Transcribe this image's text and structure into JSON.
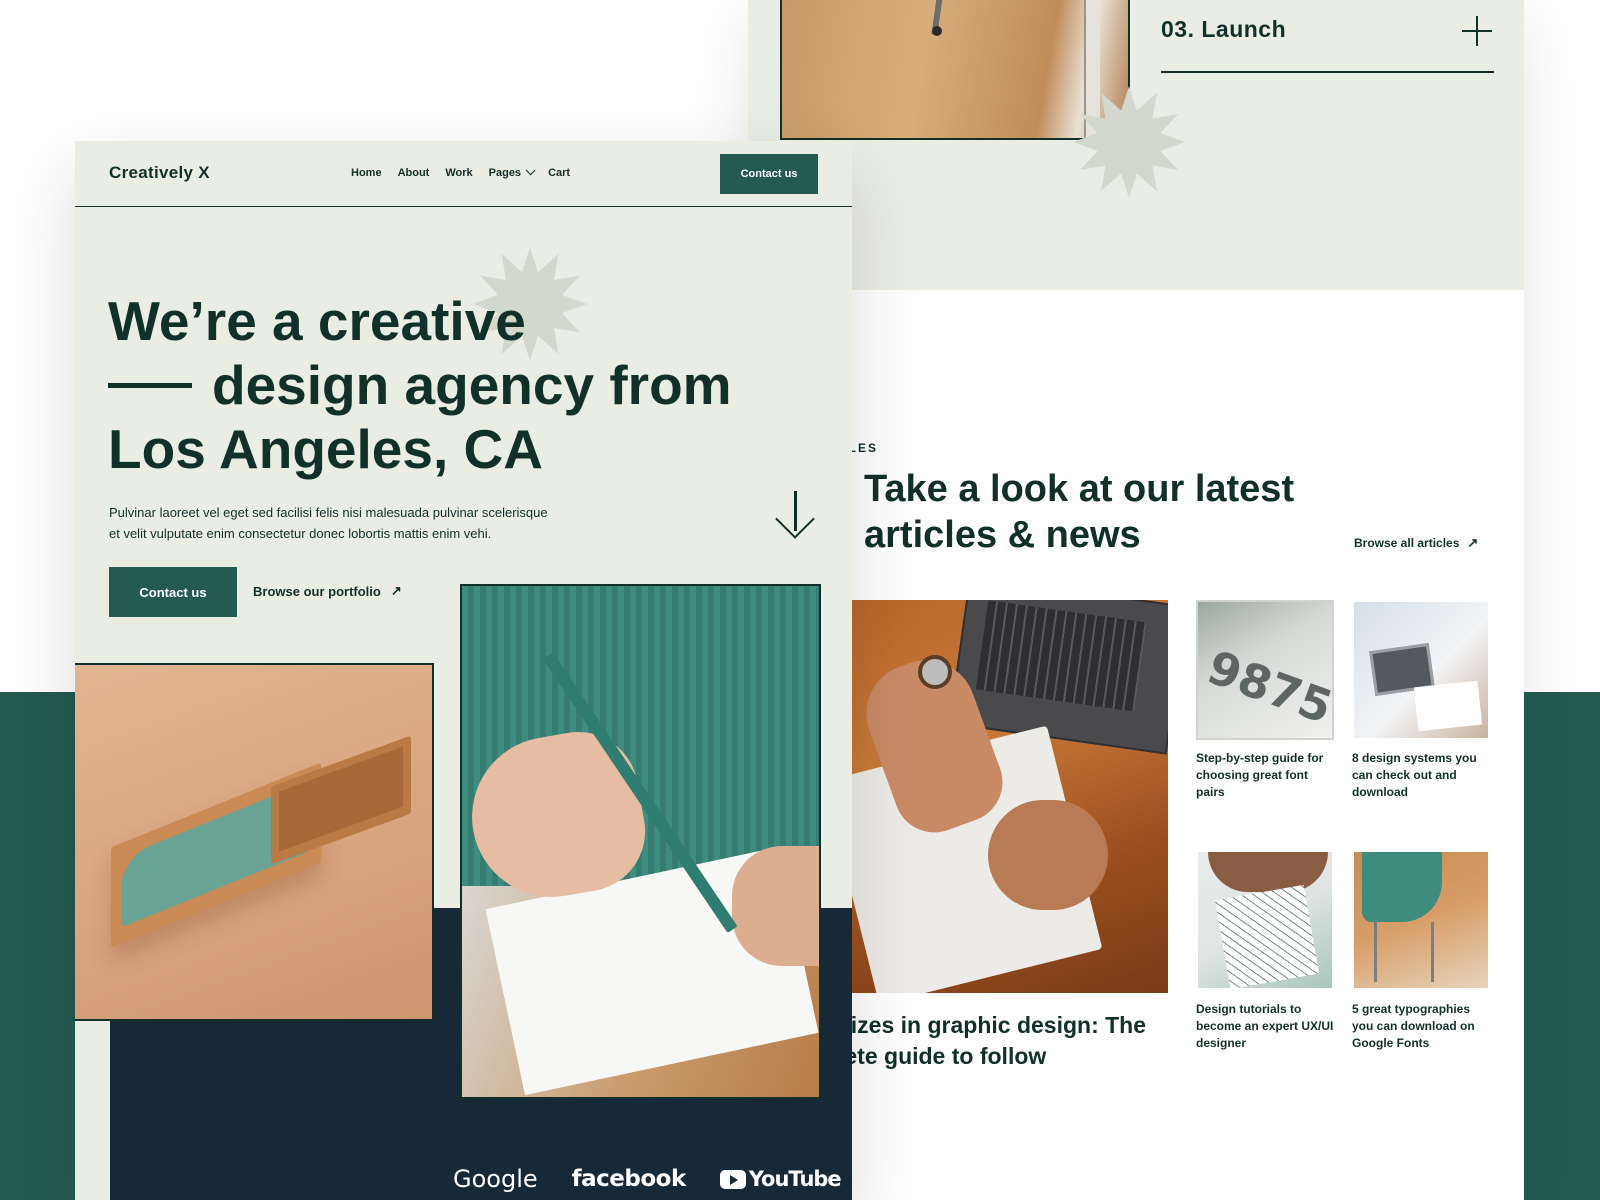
{
  "right_mockup": {
    "process": {
      "step_title": "03.  Launch"
    },
    "articles": {
      "eyebrow": "CLES",
      "heading_line1": "Take a look at our latest",
      "heading_line2": "articles & news",
      "browse_label": "Browse all articles",
      "featured_title_line1": "sizes in graphic design: The",
      "featured_title_line2": "lete guide to follow",
      "items": [
        {
          "title": "Step-by-step guide for choosing great font pairs",
          "image": "number-type-photo"
        },
        {
          "title": "8 design systems you can check out and download",
          "image": "laptop-meeting-photo"
        },
        {
          "title": "Design tutorials to become an expert UX/UI designer",
          "image": "sketching-photo"
        },
        {
          "title": "5 great typographies you can download on Google Fonts",
          "image": "office-chair-photo"
        }
      ]
    }
  },
  "left_mockup": {
    "brand": "Creatively X",
    "nav": [
      "Home",
      "About",
      "Work",
      "Pages",
      "Cart"
    ],
    "nav_cta": "Contact us",
    "hero": {
      "title_line1": "We’re a creative",
      "title_line2": "design agency from",
      "title_line3": "Los Angeles, CA",
      "description_line1": "Pulvinar laoreet vel eget sed facilisi felis nisi malesuada pulvinar scelerisque",
      "description_line2": "et velit vulputate enim consectetur donec lobortis mattis enim vehi.",
      "primary_cta": "Contact us",
      "secondary_cta": "Browse our portfolio"
    },
    "client_logos": [
      "Google",
      "facebook",
      "YouTube"
    ]
  },
  "colors": {
    "primary": "#245a50",
    "dark_navy": "#172937",
    "text": "#12302a",
    "background_light": "#eaede3"
  },
  "icons": [
    "plus-icon",
    "arrow-up-right-icon",
    "arrow-down-icon",
    "chevron-down-icon",
    "starburst-decoration",
    "youtube-play-icon"
  ]
}
